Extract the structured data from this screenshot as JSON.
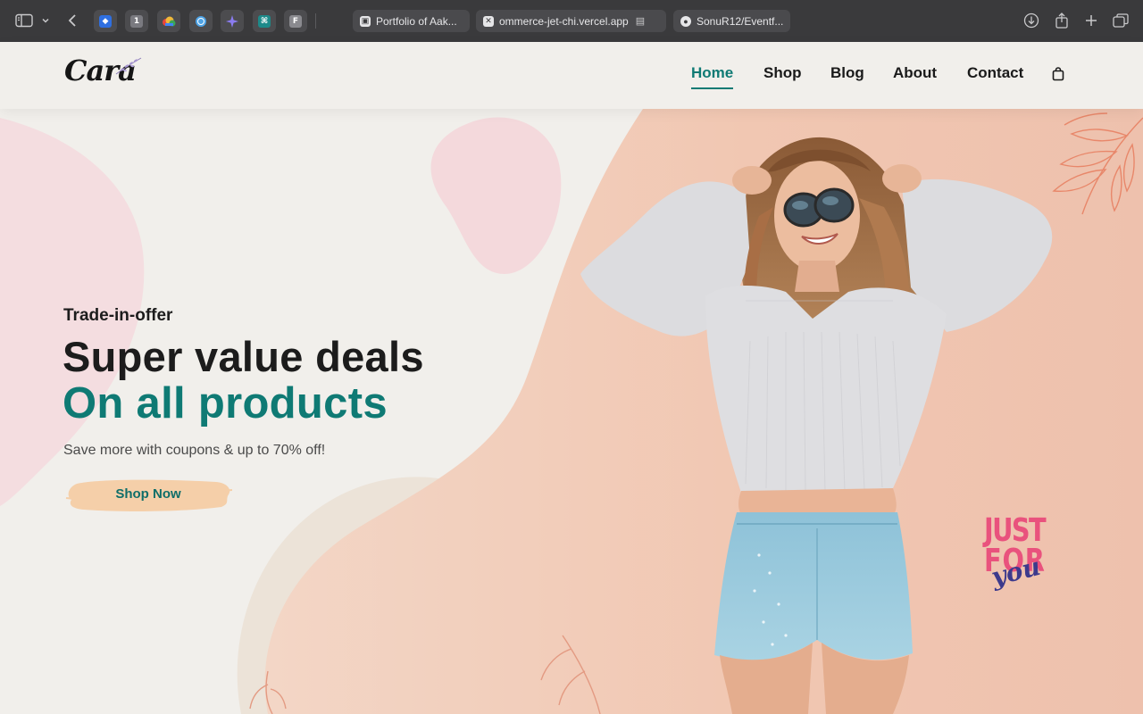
{
  "browser": {
    "pinned_tabs": [
      {
        "icon": "shield-icon",
        "color": "#2f6fe0",
        "glyph": ""
      },
      {
        "icon": "password-manager-icon",
        "color": "#7a7a80",
        "glyph": "1"
      },
      {
        "icon": "cloud-icon",
        "color": "#f0b93a",
        "glyph": ""
      },
      {
        "icon": "globe-icon",
        "color": "#4ea3e6",
        "glyph": ""
      },
      {
        "icon": "sparkle-icon",
        "color": "#8a7cf0",
        "glyph": ""
      },
      {
        "icon": "code-icon",
        "color": "#1d8a8a",
        "glyph": ""
      },
      {
        "icon": "f-app-icon",
        "color": "#8a8a8f",
        "glyph": "F"
      }
    ],
    "tabs": [
      {
        "label": "Portfolio of Aak...",
        "icon": "code-square-icon"
      },
      {
        "label": "ommerce-jet-chi.vercel.app",
        "icon": "close-icon"
      },
      {
        "label": "SonuR12/Eventf...",
        "icon": "github-icon"
      }
    ]
  },
  "site": {
    "logo": "Cara",
    "nav": [
      "Home",
      "Shop",
      "Blog",
      "About",
      "Contact"
    ],
    "active_nav": "Home",
    "accent": "#0f7a74"
  },
  "hero": {
    "offer": "Trade-in-offer",
    "headline": "Super value deals",
    "subheadline": "On all products",
    "tagline": "Save more with coupons & up to 70% off!",
    "cta": "Shop Now",
    "badge": {
      "line1": "JUST",
      "line2": "FOR",
      "line3": "you"
    }
  }
}
